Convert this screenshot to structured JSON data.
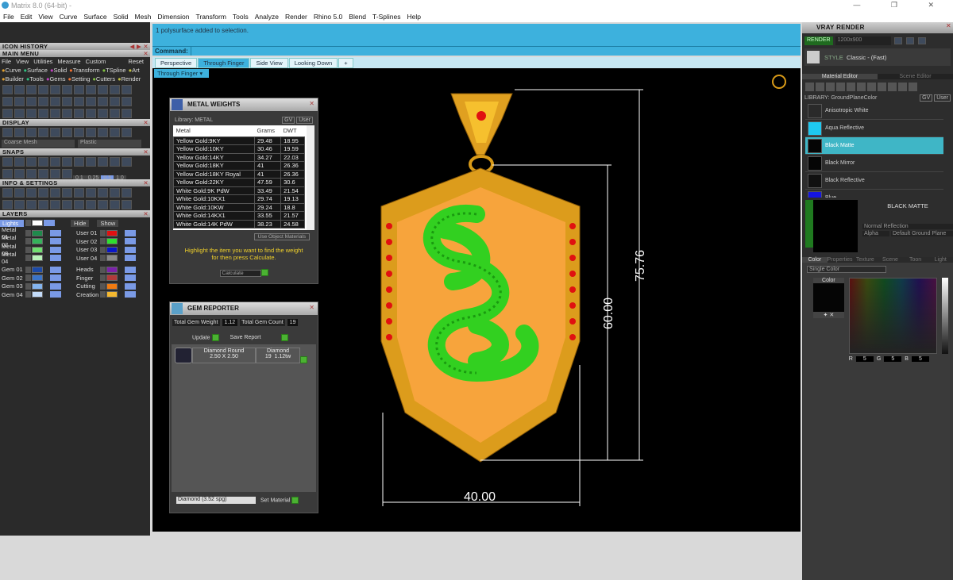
{
  "app": {
    "title": "Matrix 8.0 (64-bit) -",
    "window_controls": "— ❐ ✕"
  },
  "menu": [
    "File",
    "Edit",
    "View",
    "Curve",
    "Surface",
    "Solid",
    "Mesh",
    "Dimension",
    "Transform",
    "Tools",
    "Analyze",
    "Render",
    "Rhino 5.0",
    "Blend",
    "T-Splines",
    "Help"
  ],
  "left": {
    "icon_history": "ICON HISTORY",
    "main_menu": "MAIN MENU",
    "main_menu_items": [
      "File",
      "View",
      "Utilities",
      "Measure",
      "Custom"
    ],
    "reset": "Reset",
    "categories_row1": [
      "Curve",
      "Surface",
      "Solid",
      "Transform",
      "TSpline",
      "Art"
    ],
    "categories_row2": [
      "Builder",
      "Tools",
      "Gems",
      "Setting",
      "Cutters",
      "Render"
    ],
    "display": "DISPLAY",
    "mesh_select": "Coarse Mesh",
    "material_select": "Plastic",
    "snaps": "SNAPS",
    "snap_values": [
      "0.1",
      "0.25",
      "0.5",
      "1.0"
    ],
    "info_settings": "INFO & SETTINGS",
    "layers": "LAYERS",
    "lights": "Lights",
    "hide": "Hide",
    "show": "Show",
    "layers_left": [
      {
        "name": "Metal 01",
        "color": "#1f8a4c"
      },
      {
        "name": "Metal 02",
        "color": "#35b35a"
      },
      {
        "name": "Metal 03",
        "color": "#6fe06f"
      },
      {
        "name": "Metal 04",
        "color": "#b8f2b8"
      },
      {
        "name": "Gem 01",
        "color": "#1c4aa8"
      },
      {
        "name": "Gem 02",
        "color": "#3b74c9"
      },
      {
        "name": "Gem 03",
        "color": "#84b4ee"
      },
      {
        "name": "Gem 04",
        "color": "#c4dcfa"
      }
    ],
    "layers_right": [
      {
        "name": "User 01",
        "color": "#e01010"
      },
      {
        "name": "User 02",
        "color": "#2ee02e"
      },
      {
        "name": "User 03",
        "color": "#0a16c8"
      },
      {
        "name": "User 04",
        "color": "#8a8a8a"
      },
      {
        "name": "Heads",
        "color": "#7a22aa"
      },
      {
        "name": "Finger",
        "color": "#b03a3a"
      },
      {
        "name": "Cutting",
        "color": "#f07a10"
      },
      {
        "name": "Creation",
        "color": "#f4b830"
      }
    ]
  },
  "command": {
    "history": "1 polysurface added to selection.",
    "label": "Command:"
  },
  "tabs": [
    "Perspective",
    "Through Finger",
    "Side View",
    "Looking Down",
    "+"
  ],
  "viewport": {
    "label": "Through Finger",
    "dims": {
      "overall_height": "75.76",
      "body_height": "60.00",
      "width": "40.00"
    }
  },
  "metal_weights": {
    "title": "METAL WEIGHTS",
    "library": "Library: METAL",
    "gv": "GV",
    "user": "User",
    "columns": [
      "Metal",
      "Grams",
      "DWT"
    ],
    "rows": [
      [
        "Yellow Gold:9KY",
        "29.48",
        "18.95"
      ],
      [
        "Yellow Gold:10KY",
        "30.46",
        "19.59"
      ],
      [
        "Yellow Gold:14KY",
        "34.27",
        "22.03"
      ],
      [
        "Yellow Gold:18KY",
        "41",
        "26.36"
      ],
      [
        "Yellow Gold:18KY Royal",
        "41",
        "26.36"
      ],
      [
        "Yellow Gold:22KY",
        "47.59",
        "30.6"
      ],
      [
        "White Gold:9K PdW",
        "33.49",
        "21.54"
      ],
      [
        "White Gold:10KX1",
        "29.74",
        "19.13"
      ],
      [
        "White Gold:10KW",
        "29.24",
        "18.8"
      ],
      [
        "White Gold:14KX1",
        "33.55",
        "21.57"
      ],
      [
        "White Gold:14K PdW",
        "38.23",
        "24.58"
      ]
    ],
    "use_object_materials": "Use Object Materials",
    "hint": "Highlight the item you want to find the weight for then press Calculate.",
    "calculate": "Calculate"
  },
  "gem_reporter": {
    "title": "GEM REPORTER",
    "total_weight_label": "Total Gem Weight",
    "total_weight": "1.12",
    "total_count_label": "Total Gem Count",
    "total_count": "19",
    "update": "Update",
    "save_report": "Save Report",
    "gem": {
      "cut": "Diamond Round",
      "size": "2.50 X 2.50",
      "material": "Diamond",
      "count": "19",
      "weight": "1.12tw"
    },
    "material_select": "Diamond     (3.52 spg)",
    "set_material": "Set Material"
  },
  "vray": {
    "title": "VRAY RENDER",
    "render": "RENDER",
    "resolution": "1200x900",
    "style_label": "STYLE",
    "style": "Classic - (Fast)",
    "tabs": [
      "Material Editor",
      "Scene Editor"
    ],
    "library": "LIBRARY: GroundPlaneColor",
    "gv": "GV",
    "user": "User",
    "materials": [
      {
        "name": "Anisotropic White",
        "color": "#2a2a2a"
      },
      {
        "name": "Aqua Reflective",
        "color": "#1ec8f0"
      },
      {
        "name": "Black Matte",
        "color": "#050505"
      },
      {
        "name": "Black Mirror",
        "color": "#050505"
      },
      {
        "name": "Black Reflective",
        "color": "#111"
      },
      {
        "name": "Blue",
        "color": "#1515e0"
      }
    ],
    "selected": "BLACK MATTE",
    "reflection": "Normal Reflection",
    "alpha": "Alpha",
    "ground": "Default Ground Plane",
    "prop_tabs": [
      "Color",
      "Properties",
      "Texture",
      "Scene",
      "Toon",
      "Light"
    ],
    "color_mode": "Single Color",
    "color_label": "Color",
    "r": "5",
    "g": "5",
    "b": "5",
    "r_label": "R",
    "g_label": "G",
    "b_label": "B"
  }
}
